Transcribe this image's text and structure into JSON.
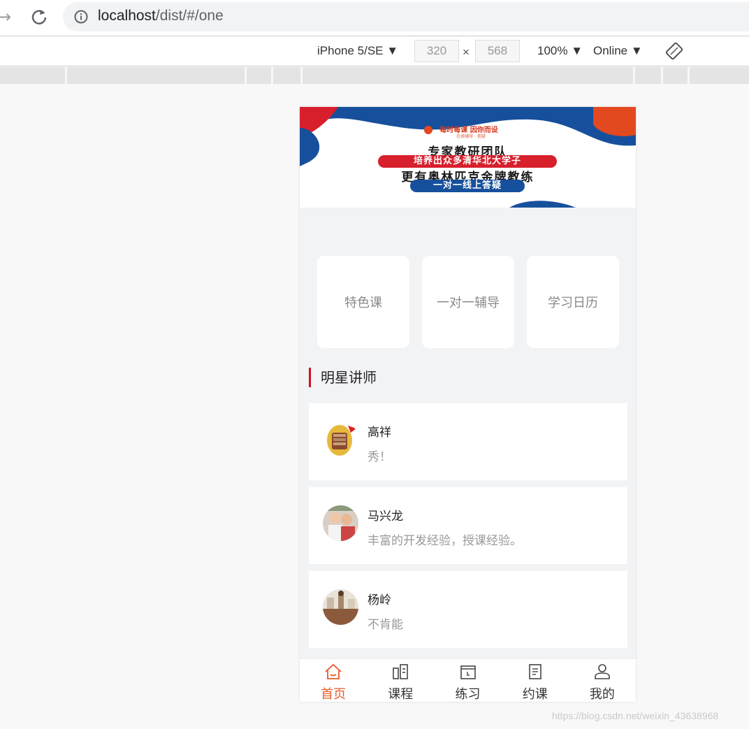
{
  "browser": {
    "url_host": "localhost",
    "url_path": "/dist/#/one"
  },
  "device_toolbar": {
    "device": "iPhone 5/SE",
    "width": "320",
    "x": "×",
    "height": "568",
    "zoom": "100%",
    "network": "Online"
  },
  "banner": {
    "tagline": "每时每课  因你而设",
    "sub": "在线辅导 · 答疑",
    "line1": "专家教研团队",
    "pill_red": "培养出众多清华北大学子",
    "line2": "更有奥林匹克金牌教练",
    "pill_blue": "一对一线上答疑"
  },
  "quick_links": [
    {
      "label": "特色课"
    },
    {
      "label": "一对一辅导"
    },
    {
      "label": "学习日历"
    }
  ],
  "section": {
    "title": "明星讲师"
  },
  "teachers": [
    {
      "name": "高祥",
      "desc": "秀！"
    },
    {
      "name": "马兴龙",
      "desc": "丰富的开发经验，授课经验。"
    },
    {
      "name": "杨岭",
      "desc": "不肯能"
    }
  ],
  "tabbar": [
    {
      "label": "首页",
      "icon": "home-icon",
      "active": true
    },
    {
      "label": "课程",
      "icon": "course-icon",
      "active": false
    },
    {
      "label": "练习",
      "icon": "practice-icon",
      "active": false
    },
    {
      "label": "约课",
      "icon": "booking-icon",
      "active": false
    },
    {
      "label": "我的",
      "icon": "user-icon",
      "active": false
    }
  ],
  "watermark": "https://blog.csdn.net/weixin_43638968",
  "colors": {
    "accent": "#e85a2a",
    "section_bar": "#d0121b",
    "banner_blue": "#16509c",
    "banner_red": "#d81f2c"
  }
}
